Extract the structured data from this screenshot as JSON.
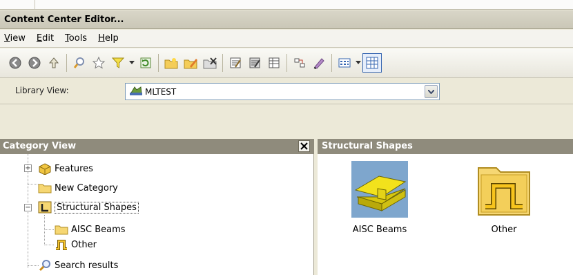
{
  "window": {
    "title": "Content Center Editor..."
  },
  "menu": [
    "View",
    "Edit",
    "Tools",
    "Help"
  ],
  "toolbar": {
    "icons": [
      "back-arrow-icon",
      "forward-arrow-icon",
      "up-folder-icon",
      "search-icon",
      "favorites-star-icon",
      "filter-icon",
      "filter-dropdown-icon",
      "refresh-icon",
      "new-category-icon",
      "edit-category-icon",
      "delete-category-icon",
      "family-properties-icon",
      "edit-family-icon",
      "table-view-icon",
      "link-icon",
      "publish-icon",
      "view-options-icon",
      "view-options-dropdown-icon",
      "detail-view-icon"
    ]
  },
  "library": {
    "label": "Library View:",
    "selected": "MLTEST"
  },
  "category_view": {
    "title": "Category View",
    "items": [
      {
        "label": "Features",
        "icon": "features-cube-icon",
        "expander": "+"
      },
      {
        "label": "New Category",
        "icon": "folder-icon"
      },
      {
        "label": "Structural Shapes",
        "icon": "structural-shapes-icon",
        "expander": "−",
        "selected": true
      },
      {
        "label": "AISC Beams",
        "icon": "folder-icon"
      },
      {
        "label": "Other",
        "icon": "other-shape-icon"
      },
      {
        "label": "Search results",
        "icon": "search-icon"
      }
    ]
  },
  "content_view": {
    "title": "Structural Shapes",
    "tiles": [
      {
        "label": "AISC Beams",
        "icon": "i-beam-icon"
      },
      {
        "label": "Other",
        "icon": "other-folder-icon"
      }
    ]
  },
  "colors": {
    "header_bg": "#8f8b7c",
    "panel_bg": "#ece9d8",
    "folder_yellow": "#f2c94c"
  }
}
